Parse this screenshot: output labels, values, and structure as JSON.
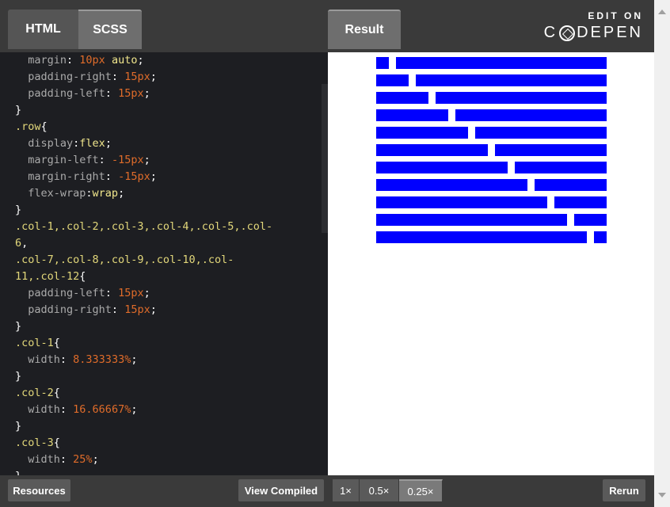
{
  "tabs": {
    "html": "HTML",
    "scss": "SCSS",
    "result": "Result"
  },
  "branding": {
    "edit_on": "EDIT ON",
    "codepen_pre": "C",
    "codepen_post": "DEPEN"
  },
  "code_lines": [
    [
      [
        "  margin",
        "prop"
      ],
      [
        ": ",
        "punct"
      ],
      [
        "10px",
        "val"
      ],
      [
        " ",
        "punct"
      ],
      [
        "auto",
        "kw"
      ],
      [
        ";",
        "punct"
      ]
    ],
    [
      [
        "  padding-right",
        "prop"
      ],
      [
        ": ",
        "punct"
      ],
      [
        "15px",
        "val"
      ],
      [
        ";",
        "punct"
      ]
    ],
    [
      [
        "  padding-left",
        "prop"
      ],
      [
        ": ",
        "punct"
      ],
      [
        "15px",
        "val"
      ],
      [
        ";",
        "punct"
      ]
    ],
    [
      [
        "}",
        "punct"
      ]
    ],
    [
      [
        ".row",
        "sel"
      ],
      [
        "{",
        "punct"
      ]
    ],
    [
      [
        "  display",
        "prop"
      ],
      [
        ":",
        "punct"
      ],
      [
        "flex",
        "kw"
      ],
      [
        ";",
        "punct"
      ]
    ],
    [
      [
        "  margin-left",
        "prop"
      ],
      [
        ": ",
        "punct"
      ],
      [
        "-15px",
        "val"
      ],
      [
        ";",
        "punct"
      ]
    ],
    [
      [
        "  margin-right",
        "prop"
      ],
      [
        ": ",
        "punct"
      ],
      [
        "-15px",
        "val"
      ],
      [
        ";",
        "punct"
      ]
    ],
    [
      [
        "  flex-wrap",
        "prop"
      ],
      [
        ":",
        "punct"
      ],
      [
        "wrap",
        "kw"
      ],
      [
        ";",
        "punct"
      ]
    ],
    [
      [
        "}",
        "punct"
      ]
    ],
    [
      [
        ".col-1,.col-2,.col-3,.col-4,.col-5,.col-",
        "sel"
      ]
    ],
    [
      [
        "6",
        "sel"
      ],
      [
        ",",
        "punct"
      ]
    ],
    [
      [
        ".col-7,.col-8,.col-9,.col-10,.col-",
        "sel"
      ]
    ],
    [
      [
        "11,.col-12",
        "sel"
      ],
      [
        "{",
        "punct"
      ]
    ],
    [
      [
        "  padding-left",
        "prop"
      ],
      [
        ": ",
        "punct"
      ],
      [
        "15px",
        "val"
      ],
      [
        ";",
        "punct"
      ]
    ],
    [
      [
        "  padding-right",
        "prop"
      ],
      [
        ": ",
        "punct"
      ],
      [
        "15px",
        "val"
      ],
      [
        ";",
        "punct"
      ]
    ],
    [
      [
        "}",
        "punct"
      ]
    ],
    [
      [
        ".col-1",
        "sel"
      ],
      [
        "{",
        "punct"
      ]
    ],
    [
      [
        "  width",
        "prop"
      ],
      [
        ": ",
        "punct"
      ],
      [
        "8.333333%",
        "val"
      ],
      [
        ";",
        "punct"
      ]
    ],
    [
      [
        "}",
        "punct"
      ]
    ],
    [
      [
        ".col-2",
        "sel"
      ],
      [
        "{",
        "punct"
      ]
    ],
    [
      [
        "  width",
        "prop"
      ],
      [
        ": ",
        "punct"
      ],
      [
        "16.66667%",
        "val"
      ],
      [
        ";",
        "punct"
      ]
    ],
    [
      [
        "}",
        "punct"
      ]
    ],
    [
      [
        ".col-3",
        "sel"
      ],
      [
        "{",
        "punct"
      ]
    ],
    [
      [
        "  width",
        "prop"
      ],
      [
        ": ",
        "punct"
      ],
      [
        "25%",
        "val"
      ],
      [
        ";",
        "punct"
      ]
    ],
    [
      [
        "}",
        "punct"
      ]
    ]
  ],
  "result_rows": [
    [
      1,
      11
    ],
    [
      2,
      10
    ],
    [
      3,
      9
    ],
    [
      4,
      8
    ],
    [
      5,
      7
    ],
    [
      6,
      6
    ],
    [
      7,
      5
    ],
    [
      8,
      4
    ],
    [
      9,
      3
    ],
    [
      10,
      2
    ],
    [
      11,
      1
    ]
  ],
  "colors": {
    "bar": "#0000ff"
  },
  "bottom": {
    "resources": "Resources",
    "view_compiled": "View Compiled",
    "zoom_options": [
      "1×",
      "0.5×",
      "0.25×"
    ],
    "zoom_selected": "0.25×",
    "rerun": "Rerun"
  }
}
